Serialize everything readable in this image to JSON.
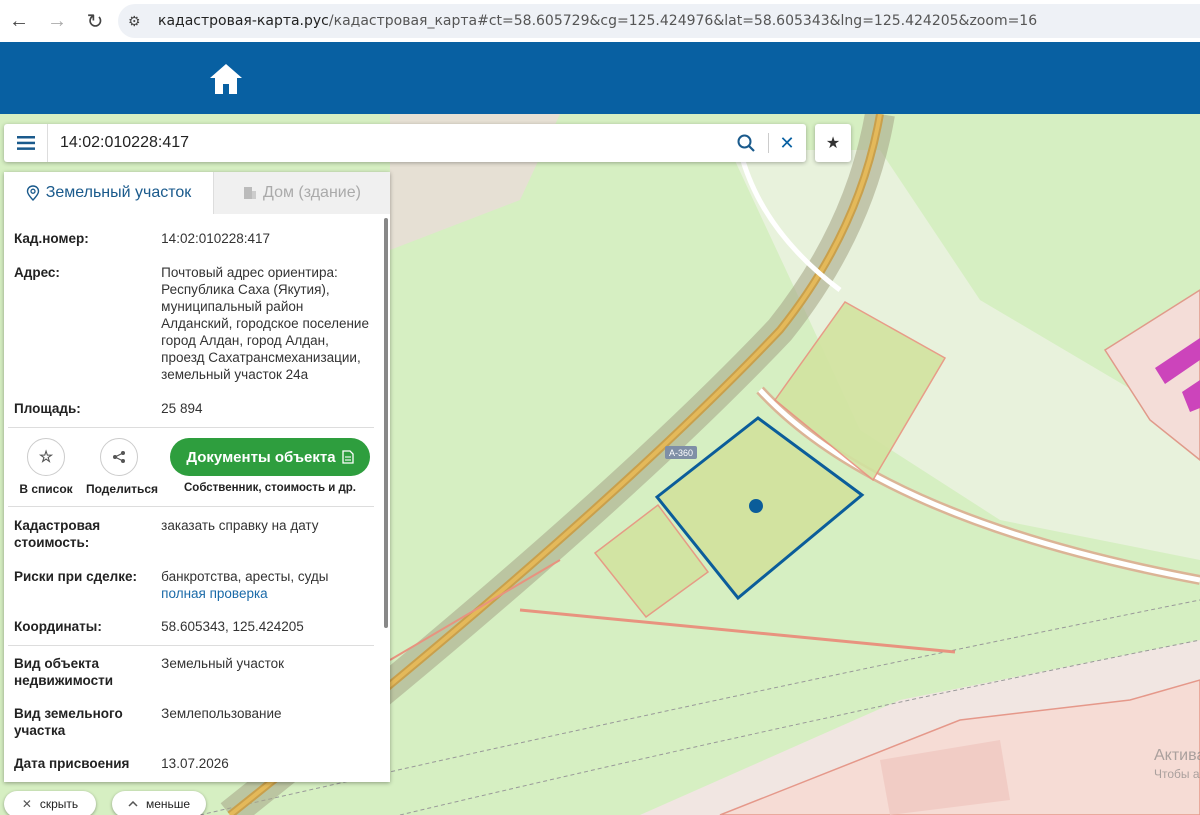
{
  "browser": {
    "url_host": "кадастровая-карта.рус",
    "url_path": "/кадастровая_карта#ct=58.605729&cg=125.424976&lat=58.605343&lng=125.424205&zoom=16"
  },
  "search": {
    "value": "14:02:010228:417"
  },
  "map": {
    "road_label": "А-360",
    "watermark_line1": "Актива",
    "watermark_line2": "Чтобы а"
  },
  "panel": {
    "tabs": [
      {
        "label": "Земельный участок",
        "icon": "location-pin-icon"
      },
      {
        "label": "Дом (здание)",
        "icon": "building-icon"
      }
    ],
    "fields": {
      "cad_number_label": "Кад.номер:",
      "cad_number_value": "14:02:010228:417",
      "address_label": "Адрес:",
      "address_value": "Почтовый адрес ориентира: Республика Саха (Якутия), муниципальный район Алданский, городское поселение город Алдан, город Алдан, проезд Сахатрансмеханизации, земельный участок 24а",
      "area_label": "Площадь:",
      "area_value": "25 894",
      "cad_cost_label": "Кадастровая стоимость:",
      "cad_cost_value": "заказать справку на дату",
      "risks_label": "Риски при сделке:",
      "risks_value": "банкротства, аресты, суды",
      "risks_link": "полная проверка",
      "coords_label": "Координаты:",
      "coords_value": "58.605343, 125.424205",
      "object_type_label": "Вид объекта недвижимости",
      "object_type_value": "Земельный участок",
      "land_type_label": "Вид земельного участка",
      "land_type_value": "Землепользование",
      "date_label": "Дата присвоения",
      "date_value": "13.07.2026"
    },
    "actions": {
      "list_label": "В список",
      "share_label": "Поделиться",
      "docs_label": "Документы объекта",
      "docs_sub": "Собственник, стоимость и др."
    }
  },
  "bottom": {
    "hide_label": "скрыть",
    "less_label": "меньше"
  },
  "colors": {
    "header": "#0860a2",
    "docs_button": "#2e9e3e",
    "parcel_outline": "#0b5d9a",
    "link": "#1a6aa8"
  }
}
